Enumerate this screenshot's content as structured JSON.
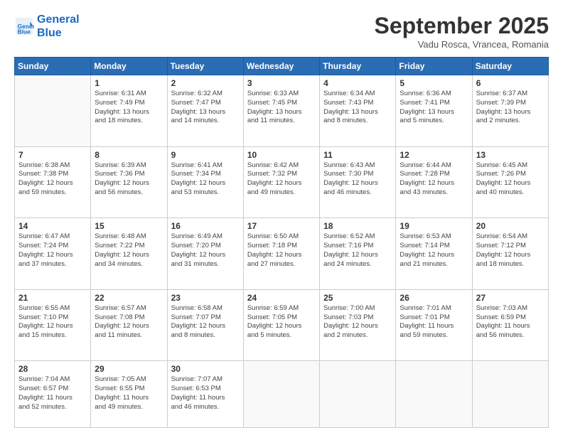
{
  "header": {
    "logo_line1": "General",
    "logo_line2": "Blue",
    "month_title": "September 2025",
    "subtitle": "Vadu Rosca, Vrancea, Romania"
  },
  "days_of_week": [
    "Sunday",
    "Monday",
    "Tuesday",
    "Wednesday",
    "Thursday",
    "Friday",
    "Saturday"
  ],
  "weeks": [
    [
      {
        "day": "",
        "sunrise": "",
        "sunset": "",
        "daylight": ""
      },
      {
        "day": "1",
        "sunrise": "6:31 AM",
        "sunset": "7:49 PM",
        "hours": "13",
        "minutes": "18"
      },
      {
        "day": "2",
        "sunrise": "6:32 AM",
        "sunset": "7:47 PM",
        "hours": "13",
        "minutes": "14"
      },
      {
        "day": "3",
        "sunrise": "6:33 AM",
        "sunset": "7:45 PM",
        "hours": "13",
        "minutes": "11"
      },
      {
        "day": "4",
        "sunrise": "6:34 AM",
        "sunset": "7:43 PM",
        "hours": "13",
        "minutes": "8"
      },
      {
        "day": "5",
        "sunrise": "6:36 AM",
        "sunset": "7:41 PM",
        "hours": "13",
        "minutes": "5"
      },
      {
        "day": "6",
        "sunrise": "6:37 AM",
        "sunset": "7:39 PM",
        "hours": "13",
        "minutes": "2"
      }
    ],
    [
      {
        "day": "7",
        "sunrise": "6:38 AM",
        "sunset": "7:38 PM",
        "hours": "12",
        "minutes": "59"
      },
      {
        "day": "8",
        "sunrise": "6:39 AM",
        "sunset": "7:36 PM",
        "hours": "12",
        "minutes": "56"
      },
      {
        "day": "9",
        "sunrise": "6:41 AM",
        "sunset": "7:34 PM",
        "hours": "12",
        "minutes": "53"
      },
      {
        "day": "10",
        "sunrise": "6:42 AM",
        "sunset": "7:32 PM",
        "hours": "12",
        "minutes": "49"
      },
      {
        "day": "11",
        "sunrise": "6:43 AM",
        "sunset": "7:30 PM",
        "hours": "12",
        "minutes": "46"
      },
      {
        "day": "12",
        "sunrise": "6:44 AM",
        "sunset": "7:28 PM",
        "hours": "12",
        "minutes": "43"
      },
      {
        "day": "13",
        "sunrise": "6:45 AM",
        "sunset": "7:26 PM",
        "hours": "12",
        "minutes": "40"
      }
    ],
    [
      {
        "day": "14",
        "sunrise": "6:47 AM",
        "sunset": "7:24 PM",
        "hours": "12",
        "minutes": "37"
      },
      {
        "day": "15",
        "sunrise": "6:48 AM",
        "sunset": "7:22 PM",
        "hours": "12",
        "minutes": "34"
      },
      {
        "day": "16",
        "sunrise": "6:49 AM",
        "sunset": "7:20 PM",
        "hours": "12",
        "minutes": "31"
      },
      {
        "day": "17",
        "sunrise": "6:50 AM",
        "sunset": "7:18 PM",
        "hours": "12",
        "minutes": "27"
      },
      {
        "day": "18",
        "sunrise": "6:52 AM",
        "sunset": "7:16 PM",
        "hours": "12",
        "minutes": "24"
      },
      {
        "day": "19",
        "sunrise": "6:53 AM",
        "sunset": "7:14 PM",
        "hours": "12",
        "minutes": "21"
      },
      {
        "day": "20",
        "sunrise": "6:54 AM",
        "sunset": "7:12 PM",
        "hours": "12",
        "minutes": "18"
      }
    ],
    [
      {
        "day": "21",
        "sunrise": "6:55 AM",
        "sunset": "7:10 PM",
        "hours": "12",
        "minutes": "15"
      },
      {
        "day": "22",
        "sunrise": "6:57 AM",
        "sunset": "7:08 PM",
        "hours": "12",
        "minutes": "11"
      },
      {
        "day": "23",
        "sunrise": "6:58 AM",
        "sunset": "7:07 PM",
        "hours": "12",
        "minutes": "8"
      },
      {
        "day": "24",
        "sunrise": "6:59 AM",
        "sunset": "7:05 PM",
        "hours": "12",
        "minutes": "5"
      },
      {
        "day": "25",
        "sunrise": "7:00 AM",
        "sunset": "7:03 PM",
        "hours": "12",
        "minutes": "2"
      },
      {
        "day": "26",
        "sunrise": "7:01 AM",
        "sunset": "7:01 PM",
        "hours": "11",
        "minutes": "59"
      },
      {
        "day": "27",
        "sunrise": "7:03 AM",
        "sunset": "6:59 PM",
        "hours": "11",
        "minutes": "56"
      }
    ],
    [
      {
        "day": "28",
        "sunrise": "7:04 AM",
        "sunset": "6:57 PM",
        "hours": "11",
        "minutes": "52"
      },
      {
        "day": "29",
        "sunrise": "7:05 AM",
        "sunset": "6:55 PM",
        "hours": "11",
        "minutes": "49"
      },
      {
        "day": "30",
        "sunrise": "7:07 AM",
        "sunset": "6:53 PM",
        "hours": "11",
        "minutes": "46"
      },
      {
        "day": "",
        "sunrise": "",
        "sunset": "",
        "hours": "",
        "minutes": ""
      },
      {
        "day": "",
        "sunrise": "",
        "sunset": "",
        "hours": "",
        "minutes": ""
      },
      {
        "day": "",
        "sunrise": "",
        "sunset": "",
        "hours": "",
        "minutes": ""
      },
      {
        "day": "",
        "sunrise": "",
        "sunset": "",
        "hours": "",
        "minutes": ""
      }
    ]
  ]
}
